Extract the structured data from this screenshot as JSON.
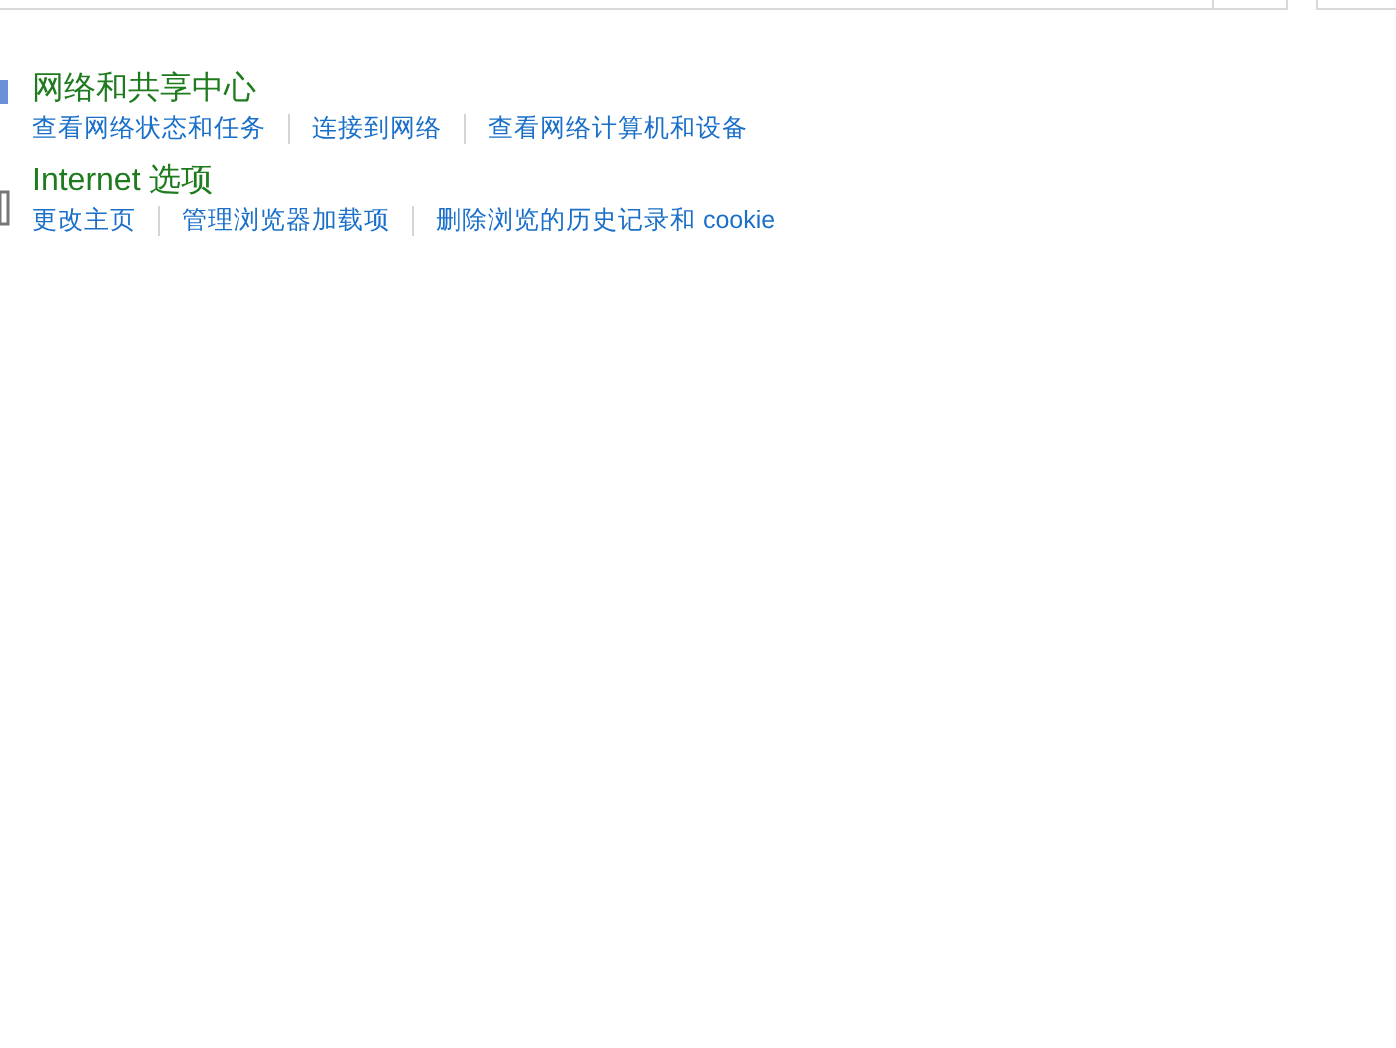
{
  "sections": [
    {
      "title": "网络和共享中心",
      "links": [
        "查看网络状态和任务",
        "连接到网络",
        "查看网络计算机和设备"
      ]
    },
    {
      "title": "Internet 选项",
      "links": [
        "更改主页",
        "管理浏览器加载项",
        "删除浏览的历史记录和 cookie"
      ]
    }
  ]
}
